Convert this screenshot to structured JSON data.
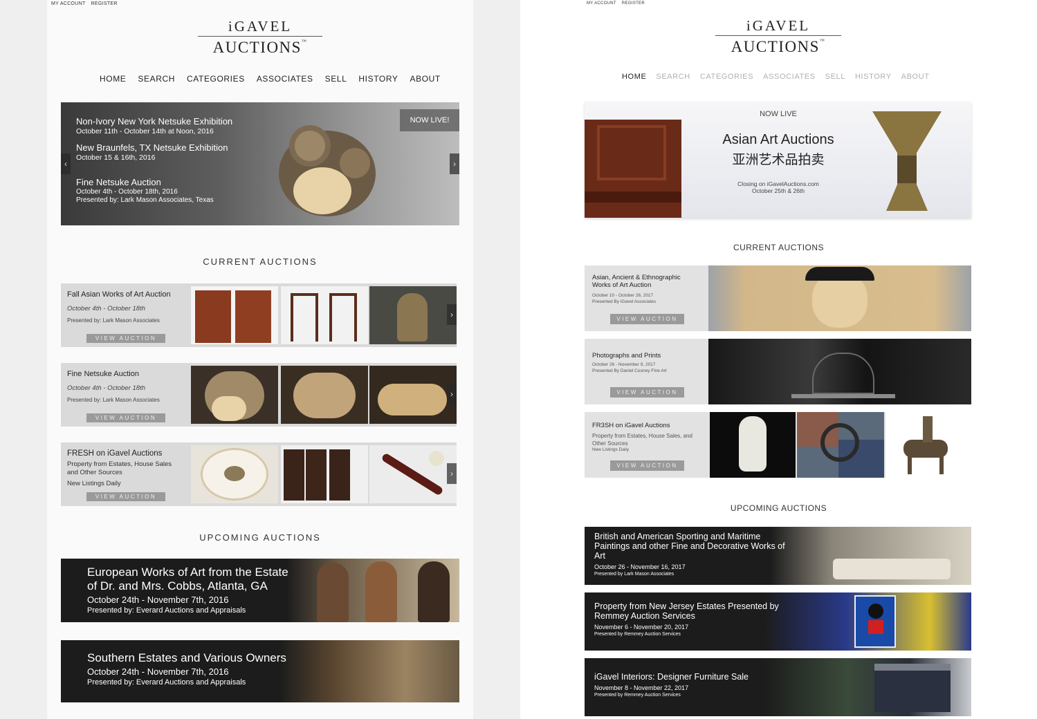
{
  "left": {
    "topbar": {
      "my_account": "MY ACCOUNT",
      "register": "REGISTER"
    },
    "logo": {
      "line1": "iGAVEL",
      "line2": "AUCTIONS",
      "tm": "™"
    },
    "nav": [
      "HOME",
      "SEARCH",
      "CATEGORIES",
      "ASSOCIATES",
      "SELL",
      "HISTORY",
      "ABOUT"
    ],
    "hero": {
      "badge": "NOW LIVE!",
      "e1_title": "Non-Ivory New York Netsuke Exhibition",
      "e1_date": "October 11th - October 14th at Noon, 2016",
      "e2_title": "New Braunfels, TX Netsuke Exhibition",
      "e2_date": "October 15 & 16th, 2016",
      "e3_title": "Fine Netsuke Auction",
      "e3_date": "October 4th - October 18th, 2016",
      "e3_pres": "Presented by: Lark Mason Associates, Texas",
      "prev": "‹",
      "next": "›"
    },
    "current_title": "CURRENT AUCTIONS",
    "current": [
      {
        "title": "Fall Asian Works of Art Auction",
        "date": "October 4th - October 18th",
        "pres": "Presented by: Lark Mason Associates",
        "btn": "VIEW AUCTION"
      },
      {
        "title": "Fine Netsuke Auction",
        "date": "October 4th - October 18th",
        "pres": "Presented by: Lark Mason Associates",
        "btn": "VIEW AUCTION"
      },
      {
        "title": "FRESH on iGavel Auctions",
        "desc1": "Property from Estates, House Sales and Other Sources",
        "desc2": "New Listings Daily",
        "btn": "VIEW AUCTION"
      }
    ],
    "arrow": "›",
    "upcoming_title": "UPCOMING AUCTIONS",
    "upcoming": [
      {
        "title1": "European Works of Art from the Estate",
        "title2": "of Dr. and Mrs. Cobbs, Atlanta, GA",
        "date": "October 24th - November 7th, 2016",
        "pres": "Presented by: Everard Auctions and Appraisals"
      },
      {
        "title1": "Southern Estates and Various Owners",
        "date": "October 24th - November 7th, 2016",
        "pres": "Presented by: Everard Auctions and Appraisals"
      }
    ]
  },
  "right": {
    "topbar": {
      "my_account": "MY ACCOUNT",
      "register": "REGISTER"
    },
    "logo": {
      "line1": "iGAVEL",
      "line2": "AUCTIONS",
      "tm": "™"
    },
    "nav": [
      "HOME",
      "SEARCH",
      "CATEGORIES",
      "ASSOCIATES",
      "SELL",
      "HISTORY",
      "ABOUT"
    ],
    "hero": {
      "now_live": "NOW LIVE",
      "title": "Asian Art Auctions",
      "chinese": "亚洲艺术品拍卖",
      "closing": "Closing on iGavelAuctions.com",
      "dates": "October 25th & 26th"
    },
    "current_title": "CURRENT AUCTIONS",
    "current": [
      {
        "title": "Asian, Ancient & Ethnographic Works of Art Auction",
        "date": "October 10 - October 26, 2017",
        "pres": "Presented By iGavel Associates",
        "btn": "VIEW AUCTION"
      },
      {
        "title": "Photographs and Prints",
        "date": "October 26 - November 9, 2017",
        "pres": "Presented By Daniel Cooney Fine Art",
        "btn": "VIEW AUCTION"
      },
      {
        "title": "FR3SH on iGavel Auctions",
        "desc": "Property from Estates, House Sales, and Other Sources",
        "desc2": "New Listings Daily",
        "btn": "VIEW AUCTION"
      }
    ],
    "upcoming_title": "UPCOMING AUCTIONS",
    "upcoming": [
      {
        "title": "British and American Sporting and Maritime Paintings and other Fine and Decorative Works of Art",
        "date": "October 26 - November 16, 2017",
        "pres": "Presented by Lark Mason Associates"
      },
      {
        "title": "Property from New Jersey Estates Presented by Remmey Auction Services",
        "date": "November 6 - November 20, 2017",
        "pres": "Presented by Remmey Auction Services"
      },
      {
        "title": "iGavel Interiors: Designer Furniture Sale",
        "date": "November 8 - November 22, 2017",
        "pres": "Presented by Remmey Auction Services"
      }
    ]
  }
}
